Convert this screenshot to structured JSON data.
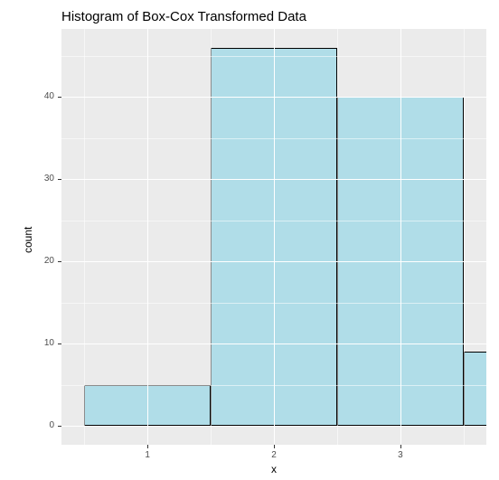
{
  "chart_data": {
    "type": "bar",
    "title": "Histogram of Box-Cox Transformed Data",
    "xlabel": "x",
    "ylabel": "count",
    "x_ticks": [
      1,
      2,
      3
    ],
    "y_ticks": [
      0,
      10,
      20,
      30,
      40
    ],
    "y_minor_ticks": [
      5,
      15,
      25,
      35,
      45
    ],
    "x_minor_ticks": [
      0.5,
      1.5,
      2.5,
      3.5
    ],
    "xlim": [
      0.32,
      3.68
    ],
    "ylim": [
      -2.3,
      48.3
    ],
    "bar_fill": "#b0dde8",
    "bar_stroke": "#000000",
    "bin_width": 1,
    "bars": [
      {
        "x_start": 0.5,
        "x_end": 1.5,
        "count": 5
      },
      {
        "x_start": 1.5,
        "x_end": 2.5,
        "count": 46
      },
      {
        "x_start": 2.5,
        "x_end": 3.5,
        "count": 40
      },
      {
        "x_start": 3.5,
        "x_end": 4.5,
        "count": 9
      }
    ]
  }
}
